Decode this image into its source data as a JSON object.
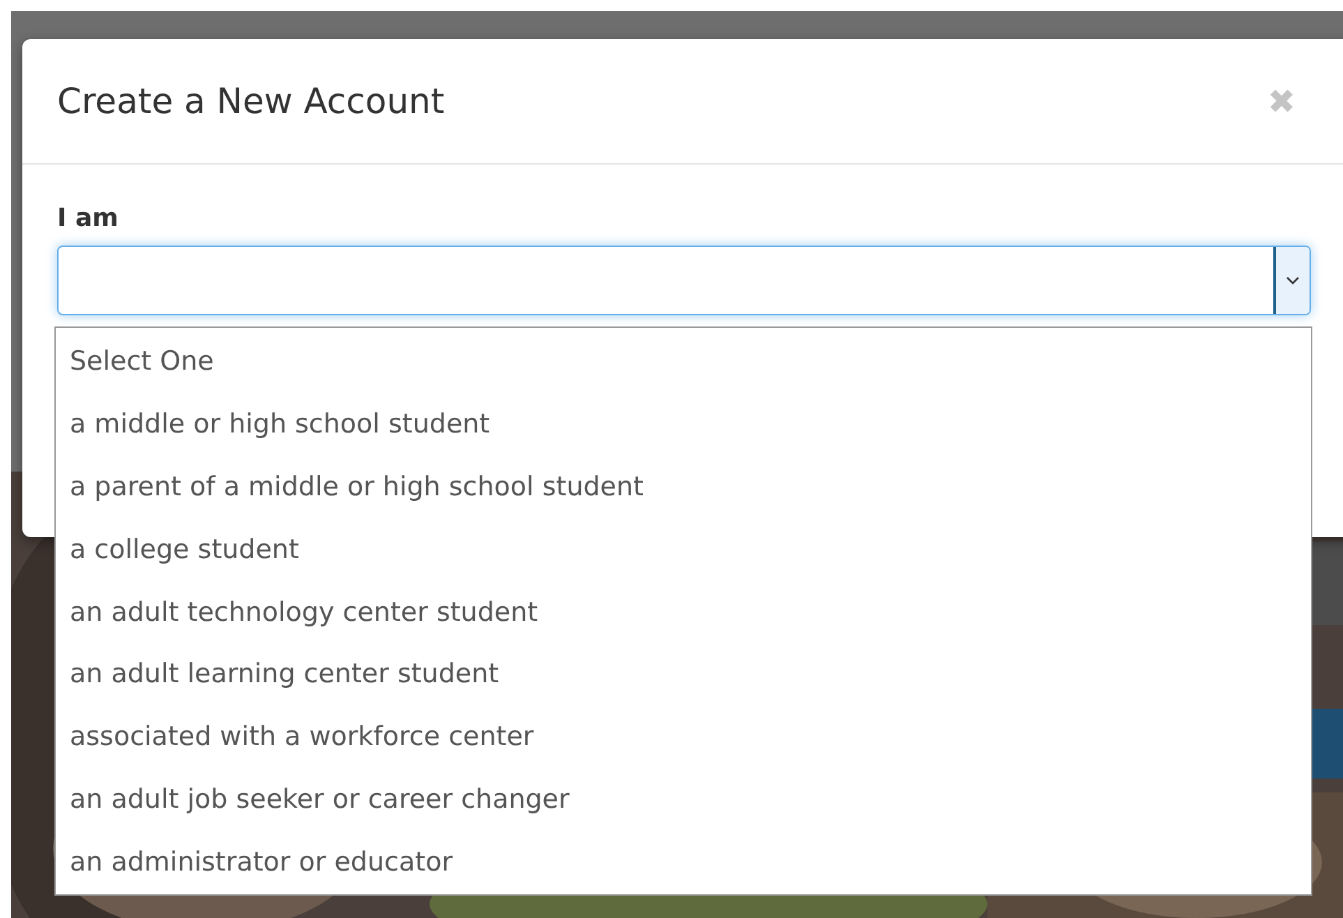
{
  "dialog": {
    "title": "Create a New Account",
    "close": "✖"
  },
  "field": {
    "label": "I am",
    "expanded": true,
    "options": [
      {
        "label": "Select One",
        "selected": false
      },
      {
        "label": "a middle or high school student",
        "selected": false
      },
      {
        "label": "a parent of a middle or high school student",
        "selected": false
      },
      {
        "label": "a college student",
        "selected": false
      },
      {
        "label": "an adult technology center student",
        "selected": false
      },
      {
        "label": "an adult learning center student",
        "selected": false
      },
      {
        "label": "associated with a workforce center",
        "selected": false
      },
      {
        "label": "an adult job seeker or career changer",
        "selected": false
      },
      {
        "label": "an administrator or educator",
        "selected": false
      }
    ]
  }
}
